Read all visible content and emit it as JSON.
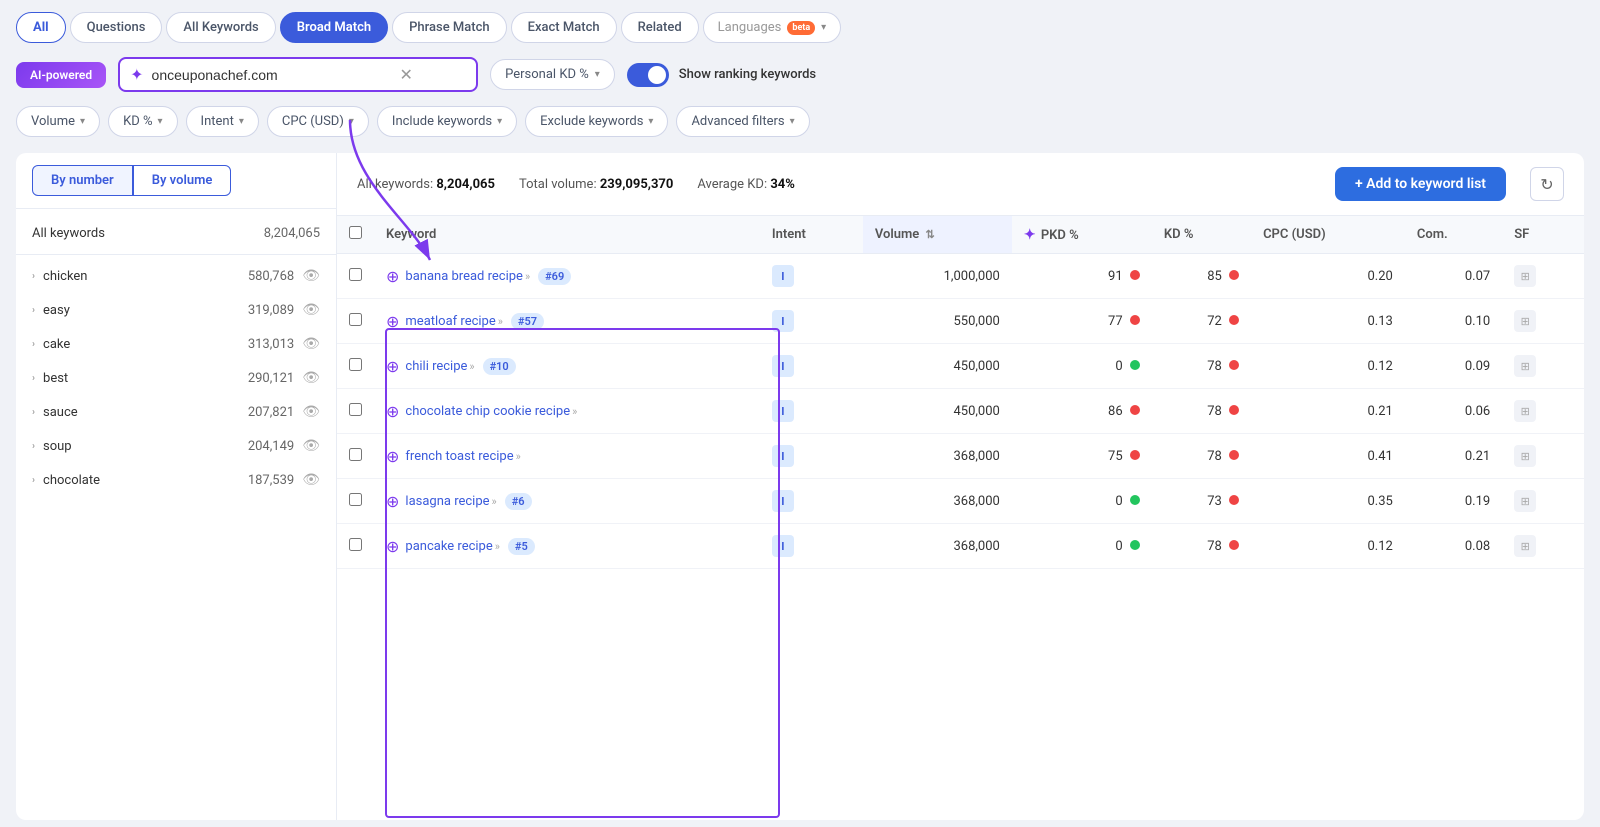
{
  "tabs": [
    {
      "id": "all",
      "label": "All",
      "state": "active"
    },
    {
      "id": "questions",
      "label": "Questions",
      "state": "normal"
    },
    {
      "id": "all-keywords",
      "label": "All Keywords",
      "state": "normal"
    },
    {
      "id": "broad-match",
      "label": "Broad Match",
      "state": "selected"
    },
    {
      "id": "phrase-match",
      "label": "Phrase Match",
      "state": "normal"
    },
    {
      "id": "exact-match",
      "label": "Exact Match",
      "state": "normal"
    },
    {
      "id": "related",
      "label": "Related",
      "state": "normal"
    }
  ],
  "languages_label": "Languages",
  "beta_label": "beta",
  "ai_badge_label": "AI-powered",
  "search_value": "onceuponachef.com",
  "personal_kd_label": "Personal KD %",
  "show_ranking_label": "Show ranking keywords",
  "filters": [
    {
      "id": "volume",
      "label": "Volume"
    },
    {
      "id": "kd",
      "label": "KD %"
    },
    {
      "id": "intent",
      "label": "Intent"
    },
    {
      "id": "cpc",
      "label": "CPC (USD)"
    },
    {
      "id": "include",
      "label": "Include keywords"
    },
    {
      "id": "exclude",
      "label": "Exclude keywords"
    },
    {
      "id": "advanced",
      "label": "Advanced filters"
    }
  ],
  "view_buttons": [
    {
      "id": "by-number",
      "label": "By number",
      "active": true
    },
    {
      "id": "by-volume",
      "label": "By volume",
      "active": false
    }
  ],
  "sidebar_header": "All keywords",
  "sidebar_total": "8,204,065",
  "sidebar_items": [
    {
      "label": "chicken",
      "count": "580,768"
    },
    {
      "label": "easy",
      "count": "319,089"
    },
    {
      "label": "cake",
      "count": "313,013"
    },
    {
      "label": "best",
      "count": "290,121"
    },
    {
      "label": "sauce",
      "count": "207,821"
    },
    {
      "label": "soup",
      "count": "204,149"
    },
    {
      "label": "chocolate",
      "count": "187,539"
    }
  ],
  "stats": {
    "all_keywords_label": "All keywords:",
    "all_keywords_value": "8,204,065",
    "total_volume_label": "Total volume:",
    "total_volume_value": "239,095,370",
    "avg_kd_label": "Average KD:",
    "avg_kd_value": "34%"
  },
  "add_button_label": "+ Add to keyword list",
  "table_columns": [
    {
      "id": "keyword",
      "label": "Keyword"
    },
    {
      "id": "intent",
      "label": "Intent"
    },
    {
      "id": "volume",
      "label": "Volume",
      "sortable": true
    },
    {
      "id": "pkd",
      "label": "PKD %"
    },
    {
      "id": "kd",
      "label": "KD %"
    },
    {
      "id": "cpc",
      "label": "CPC (USD)"
    },
    {
      "id": "com",
      "label": "Com."
    },
    {
      "id": "sf",
      "label": "SF"
    }
  ],
  "rows": [
    {
      "keyword": "banana bread recipe",
      "rank": "#69",
      "intent": "I",
      "volume": "1,000,000",
      "pkd": "91",
      "pkd_dot": "red",
      "kd": "85",
      "kd_dot": "red",
      "cpc": "0.20",
      "com": "0.07"
    },
    {
      "keyword": "meatloaf recipe",
      "rank": "#57",
      "intent": "I",
      "volume": "550,000",
      "pkd": "77",
      "pkd_dot": "red",
      "kd": "72",
      "kd_dot": "red",
      "cpc": "0.13",
      "com": "0.10"
    },
    {
      "keyword": "chili recipe",
      "rank": "#10",
      "intent": "I",
      "volume": "450,000",
      "pkd": "0",
      "pkd_dot": "green",
      "kd": "78",
      "kd_dot": "red",
      "cpc": "0.12",
      "com": "0.09"
    },
    {
      "keyword": "chocolate chip cookie recipe",
      "rank": null,
      "intent": "I",
      "volume": "450,000",
      "pkd": "86",
      "pkd_dot": "red",
      "kd": "78",
      "kd_dot": "red",
      "cpc": "0.21",
      "com": "0.06"
    },
    {
      "keyword": "french toast recipe",
      "rank": null,
      "intent": "I",
      "volume": "368,000",
      "pkd": "75",
      "pkd_dot": "red",
      "kd": "78",
      "kd_dot": "red",
      "cpc": "0.41",
      "com": "0.21"
    },
    {
      "keyword": "lasagna recipe",
      "rank": "#6",
      "intent": "I",
      "volume": "368,000",
      "pkd": "0",
      "pkd_dot": "green",
      "kd": "73",
      "kd_dot": "red",
      "cpc": "0.35",
      "com": "0.19"
    },
    {
      "keyword": "pancake recipe",
      "rank": "#5",
      "intent": "I",
      "volume": "368,000",
      "pkd": "0",
      "pkd_dot": "green",
      "kd": "78",
      "kd_dot": "red",
      "cpc": "0.12",
      "com": "0.08"
    }
  ]
}
